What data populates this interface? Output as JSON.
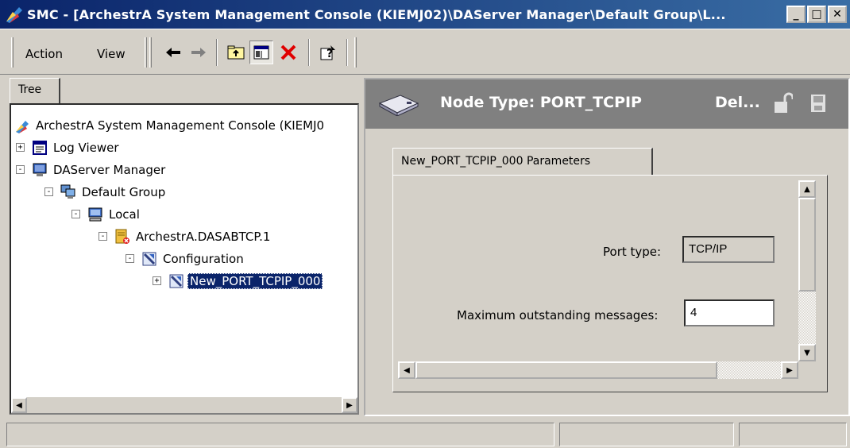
{
  "window": {
    "title": "SMC - [ArchestrA System Management Console (KIEMJ02)\\DAServer Manager\\Default Group\\L..."
  },
  "menu": {
    "action": "Action",
    "view": "View"
  },
  "toolbar": {
    "buttons": [
      "back-icon",
      "forward-icon",
      "up-folder-icon",
      "show-hide-tree-icon",
      "delete-icon",
      "help-icon"
    ]
  },
  "tree": {
    "tab_label": "Tree",
    "items": [
      {
        "label": "ArchestrA System Management Console (KIEMJ0",
        "icon": "smc-icon"
      },
      {
        "label": "Log Viewer",
        "icon": "log-viewer-icon",
        "expander": "+"
      },
      {
        "label": "DAServer Manager",
        "icon": "daserver-manager-icon",
        "expander": "-"
      },
      {
        "label": "Default Group",
        "icon": "group-icon",
        "expander": "-"
      },
      {
        "label": "Local",
        "icon": "computer-icon",
        "expander": "-"
      },
      {
        "label": "ArchestrA.DASABTCP.1",
        "icon": "daserver-icon",
        "expander": "-"
      },
      {
        "label": "Configuration",
        "icon": "configuration-icon",
        "expander": "-"
      },
      {
        "label": "New_PORT_TCPIP_000",
        "icon": "port-node-icon",
        "expander": "+"
      }
    ]
  },
  "node_header": {
    "title": "Node Type: PORT_TCPIP",
    "delimiter_label": "Del..."
  },
  "parameters": {
    "tab_label": "New_PORT_TCPIP_000 Parameters",
    "port_type_label": "Port type:",
    "port_type_value": "TCP/IP",
    "max_messages_label": "Maximum outstanding messages:",
    "max_messages_value": "4"
  },
  "colors": {
    "title_bar_start": "#0a246a",
    "title_bar_end": "#3a6ea5",
    "selection": "#0a246a",
    "header_bg": "#808080"
  }
}
